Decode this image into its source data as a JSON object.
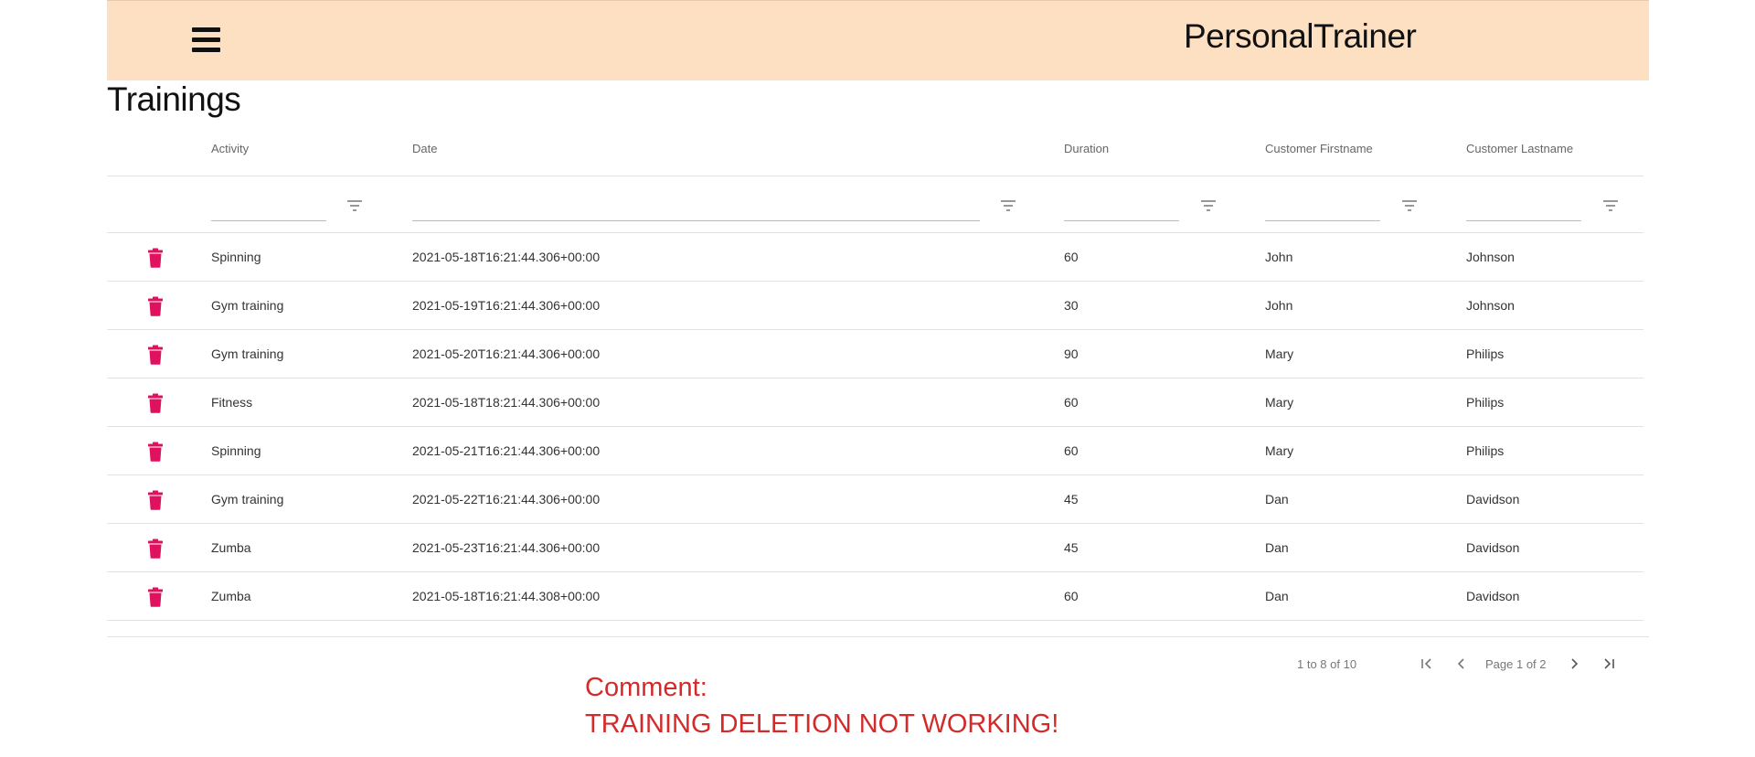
{
  "app_bar": {
    "title": "PersonalTrainer",
    "menu_icon": "hamburger-menu-icon"
  },
  "page": {
    "title": "Trainings"
  },
  "grid": {
    "columns": [
      "Activity",
      "Date",
      "Duration",
      "Customer Firstname",
      "Customer Lastname"
    ],
    "filter_icon": "filter-icon",
    "delete_icon": "trash-icon",
    "delete_color": "#e0115f",
    "rows": [
      [
        "Spinning",
        "2021-05-18T16:21:44.306+00:00",
        "60",
        "John",
        "Johnson"
      ],
      [
        "Gym training",
        "2021-05-19T16:21:44.306+00:00",
        "30",
        "John",
        "Johnson"
      ],
      [
        "Gym training",
        "2021-05-20T16:21:44.306+00:00",
        "90",
        "Mary",
        "Philips"
      ],
      [
        "Fitness",
        "2021-05-18T18:21:44.306+00:00",
        "60",
        "Mary",
        "Philips"
      ],
      [
        "Spinning",
        "2021-05-21T16:21:44.306+00:00",
        "60",
        "Mary",
        "Philips"
      ],
      [
        "Gym training",
        "2021-05-22T16:21:44.306+00:00",
        "45",
        "Dan",
        "Davidson"
      ],
      [
        "Zumba",
        "2021-05-23T16:21:44.306+00:00",
        "45",
        "Dan",
        "Davidson"
      ],
      [
        "Zumba",
        "2021-05-18T16:21:44.308+00:00",
        "60",
        "Dan",
        "Davidson"
      ]
    ]
  },
  "pagination": {
    "summary": "1 to 8 of 10",
    "page_label": "Page 1 of 2"
  },
  "comment": {
    "line1": "Comment:",
    "line2": "TRAINING DELETION NOT WORKING!",
    "color": "#d42a2a"
  },
  "colors": {
    "app_bar_bg": "#fde0c2"
  }
}
